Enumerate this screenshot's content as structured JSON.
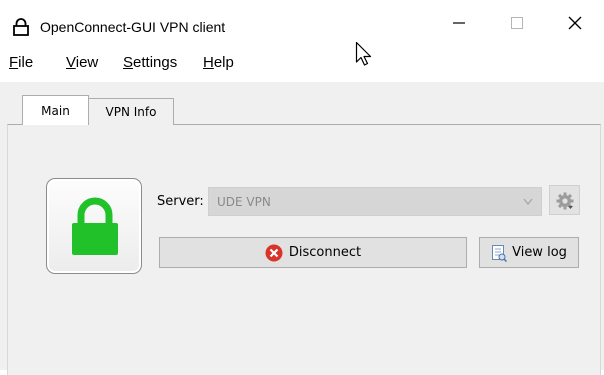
{
  "window": {
    "title": "OpenConnect-GUI VPN client",
    "app_icon": "lock-outline-icon",
    "controls": [
      "minimize-icon",
      "maximize-icon",
      "close-icon"
    ]
  },
  "menu": {
    "items": [
      {
        "mnemonic": "F",
        "rest": "ile"
      },
      {
        "mnemonic": "V",
        "rest": "iew"
      },
      {
        "mnemonic": "S",
        "rest": "ettings"
      },
      {
        "mnemonic": "H",
        "rest": "elp"
      }
    ]
  },
  "tabs": [
    {
      "label": "Main",
      "active": true
    },
    {
      "label": "VPN Info",
      "active": false
    }
  ],
  "main": {
    "status_icon": "green-padlock-locked-icon",
    "server": {
      "label": "Server:",
      "value": "UDE VPN",
      "enabled": false
    },
    "settings_button_icon": "gear-icon",
    "disconnect": {
      "label": "Disconnect",
      "icon": "red-x-circle-icon"
    },
    "view_log": {
      "label": "View log",
      "icon": "log-page-icon"
    }
  },
  "colors": {
    "lock_green": "#21c12a",
    "disconnect_red": "#d9342b",
    "window_bg": "#f0f0f0"
  }
}
